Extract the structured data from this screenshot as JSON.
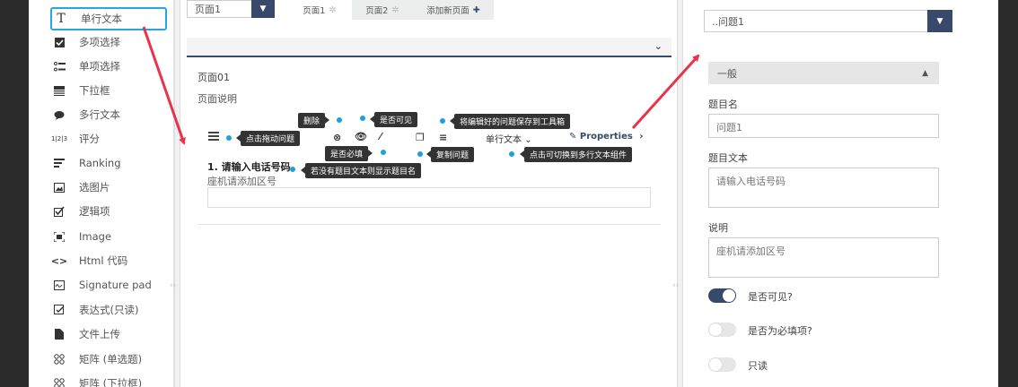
{
  "toolbox": {
    "items": [
      {
        "label": "单行文本",
        "icon": "text-t-icon",
        "glyph": "T"
      },
      {
        "label": "多项选择",
        "icon": "checkbox-icon",
        "glyph": "☑"
      },
      {
        "label": "单项选择",
        "icon": "radio-list-icon",
        "glyph": "☰"
      },
      {
        "label": "下拉框",
        "icon": "dropdown-icon",
        "glyph": "▤"
      },
      {
        "label": "多行文本",
        "icon": "comment-icon",
        "glyph": "●"
      },
      {
        "label": "评分",
        "icon": "rating-icon",
        "glyph": "1|2|3"
      },
      {
        "label": "Ranking",
        "icon": "ranking-icon",
        "glyph": "≡"
      },
      {
        "label": "选图片",
        "icon": "image-picker-icon",
        "glyph": "▣"
      },
      {
        "label": "逻辑项",
        "icon": "boolean-icon",
        "glyph": "☑"
      },
      {
        "label": "Image",
        "icon": "image-icon",
        "glyph": "⊡"
      },
      {
        "label": "Html 代码",
        "icon": "code-icon",
        "glyph": "‹›"
      },
      {
        "label": "Signature pad",
        "icon": "signature-icon",
        "glyph": "✍"
      },
      {
        "label": "表达式(只读)",
        "icon": "expression-icon",
        "glyph": "▢"
      },
      {
        "label": "文件上传",
        "icon": "file-icon",
        "glyph": "▮"
      },
      {
        "label": "矩阵 (单选题)",
        "icon": "matrix-icon",
        "glyph": "⁘"
      },
      {
        "label": "矩阵 (下拉框)",
        "icon": "matrix-dropdown-icon",
        "glyph": "⁘"
      }
    ]
  },
  "designer": {
    "page_select": "页面1",
    "tabs": [
      "页面1",
      "页面2",
      "添加新页面"
    ],
    "add_glyph": "✚",
    "page_title": "页面01",
    "page_description": "页面说明",
    "question_title": "1. 请输入电话号码",
    "question_description": "座机请添加区号",
    "question_type": "单行文本",
    "properties_label": "Properties",
    "tips": {
      "drag": "点击拖动问题",
      "delete": "删除",
      "visible": "是否可见",
      "save_toolbox": "将编辑好的问题保存到工具箱",
      "required": "是否必填",
      "copy": "复制问题",
      "convert": "点击可切换到多行文本组件",
      "no_title": "若没有题目文本则显示题目名"
    }
  },
  "properties": {
    "question_select": "..问题1",
    "category": "一般",
    "name_label": "题目名",
    "name_value": "问题1",
    "title_label": "题目文本",
    "title_value": "请输入电话号码",
    "description_label": "说明",
    "description_value": "座机请添加区号",
    "toggles": [
      {
        "label": "是否可见?",
        "on": true
      },
      {
        "label": "是否为必填项?",
        "on": false
      },
      {
        "label": "只读",
        "on": false
      }
    ]
  },
  "colors": {
    "accent": "#374a6b",
    "highlight": "#28a5e2",
    "arrow": "#e8344a",
    "tooltip": "#333333"
  }
}
